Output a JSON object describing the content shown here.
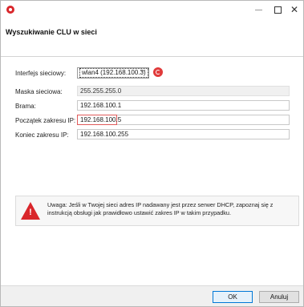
{
  "dialog": {
    "title": "Wyszukiwanie CLU w sieci"
  },
  "form": {
    "interface": {
      "label": "Interfejs sieciowy:",
      "value": "wlan4 (192.168.100.3)"
    },
    "mask": {
      "label": "Maska sieciowa:",
      "value": "255.255.255.0"
    },
    "gateway": {
      "label": "Brama:",
      "value": "192.168.100.1"
    },
    "range_start": {
      "label": "Początek zakresu IP:",
      "value": "192.168.100.5"
    },
    "range_end": {
      "label": "Koniec zakresu IP:",
      "value": "192.168.100.255"
    }
  },
  "warning": {
    "text": "Uwaga: Jeśli w Twojej sieci adres IP nadawany jest przez serwer DHCP, zapoznaj się z instrukcją obsługi jak prawidłowo ustawić zakres IP w takim przypadku."
  },
  "buttons": {
    "ok": "OK",
    "cancel": "Anuluj"
  },
  "colors": {
    "accent_red": "#d9262b",
    "ok_border": "#0078d7"
  },
  "icons": {
    "app": "app-icon",
    "refresh": "refresh-icon",
    "warning": "warning-icon"
  }
}
